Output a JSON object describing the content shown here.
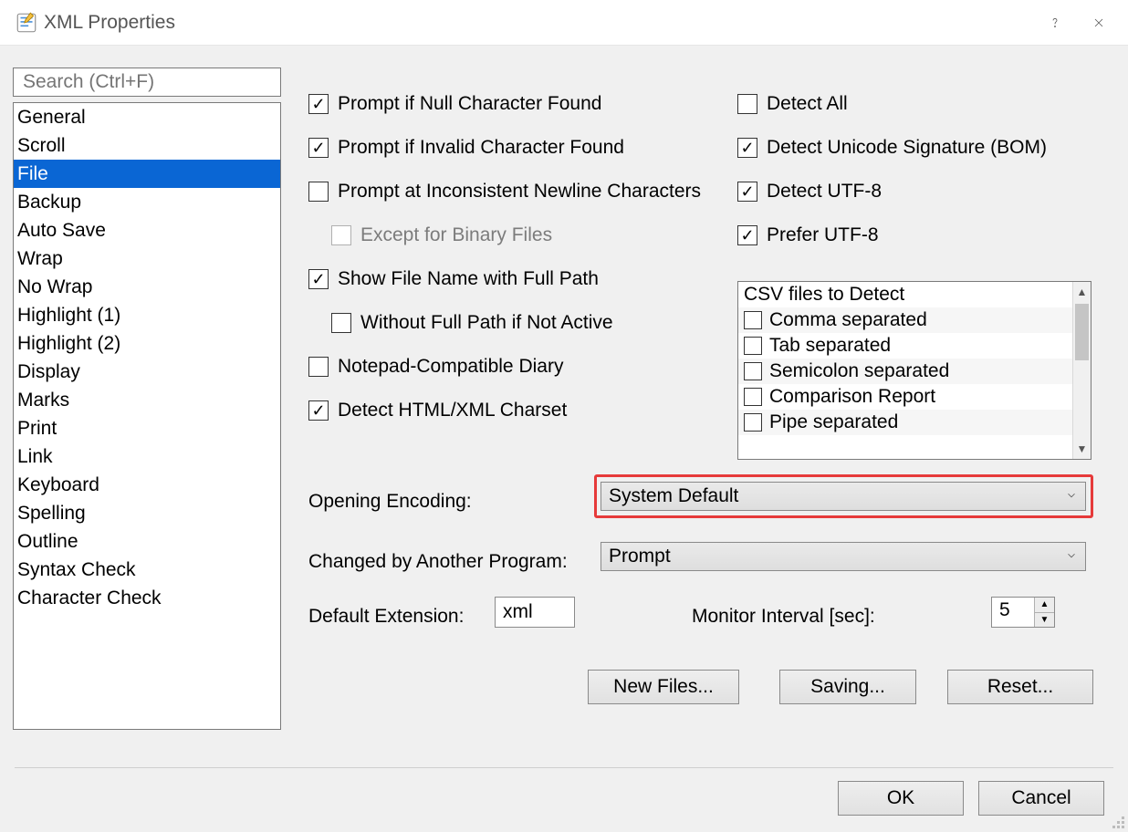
{
  "window": {
    "title": "XML Properties"
  },
  "search": {
    "placeholder": "Search (Ctrl+F)"
  },
  "categories": [
    {
      "label": "General"
    },
    {
      "label": "Scroll"
    },
    {
      "label": "File",
      "selected": true
    },
    {
      "label": "Backup"
    },
    {
      "label": "Auto Save"
    },
    {
      "label": "Wrap"
    },
    {
      "label": "No Wrap"
    },
    {
      "label": "Highlight (1)"
    },
    {
      "label": "Highlight (2)"
    },
    {
      "label": "Display"
    },
    {
      "label": "Marks"
    },
    {
      "label": "Print"
    },
    {
      "label": "Link"
    },
    {
      "label": "Keyboard"
    },
    {
      "label": "Spelling"
    },
    {
      "label": "Outline"
    },
    {
      "label": "Syntax Check"
    },
    {
      "label": "Character Check"
    }
  ],
  "left_checks": {
    "prompt_null": {
      "label": "Prompt if Null Character Found",
      "checked": true
    },
    "prompt_invalid": {
      "label": "Prompt if Invalid Character Found",
      "checked": true
    },
    "prompt_newline": {
      "label": "Prompt at Inconsistent Newline Characters",
      "checked": false
    },
    "except_binary": {
      "label": "Except for Binary Files",
      "checked": false,
      "disabled": true
    },
    "show_full_path": {
      "label": "Show File Name with Full Path",
      "checked": true
    },
    "without_full": {
      "label": "Without Full Path if Not Active",
      "checked": false
    },
    "notepad_diary": {
      "label": "Notepad-Compatible Diary",
      "checked": false
    },
    "detect_html": {
      "label": "Detect HTML/XML Charset",
      "checked": true
    }
  },
  "right_checks": {
    "detect_all": {
      "label": "Detect All",
      "checked": false
    },
    "detect_bom": {
      "label": "Detect Unicode Signature (BOM)",
      "checked": true
    },
    "detect_utf8": {
      "label": "Detect UTF-8",
      "checked": true
    },
    "prefer_utf8": {
      "label": "Prefer UTF-8",
      "checked": true
    }
  },
  "csv": {
    "heading": "CSV files to Detect",
    "items": [
      {
        "label": "Comma separated",
        "checked": false
      },
      {
        "label": "Tab separated",
        "checked": false
      },
      {
        "label": "Semicolon separated",
        "checked": false
      },
      {
        "label": "Comparison Report",
        "checked": false
      },
      {
        "label": "Pipe separated",
        "checked": false
      }
    ]
  },
  "form": {
    "opening_encoding_label": "Opening Encoding:",
    "opening_encoding_value": "System Default",
    "changed_label": "Changed by Another Program:",
    "changed_value": "Prompt",
    "default_ext_label": "Default Extension:",
    "default_ext_value": "xml",
    "monitor_label": "Monitor Interval [sec]:",
    "monitor_value": "5"
  },
  "buttons": {
    "new_files": "New Files...",
    "saving": "Saving...",
    "reset": "Reset...",
    "ok": "OK",
    "cancel": "Cancel"
  }
}
